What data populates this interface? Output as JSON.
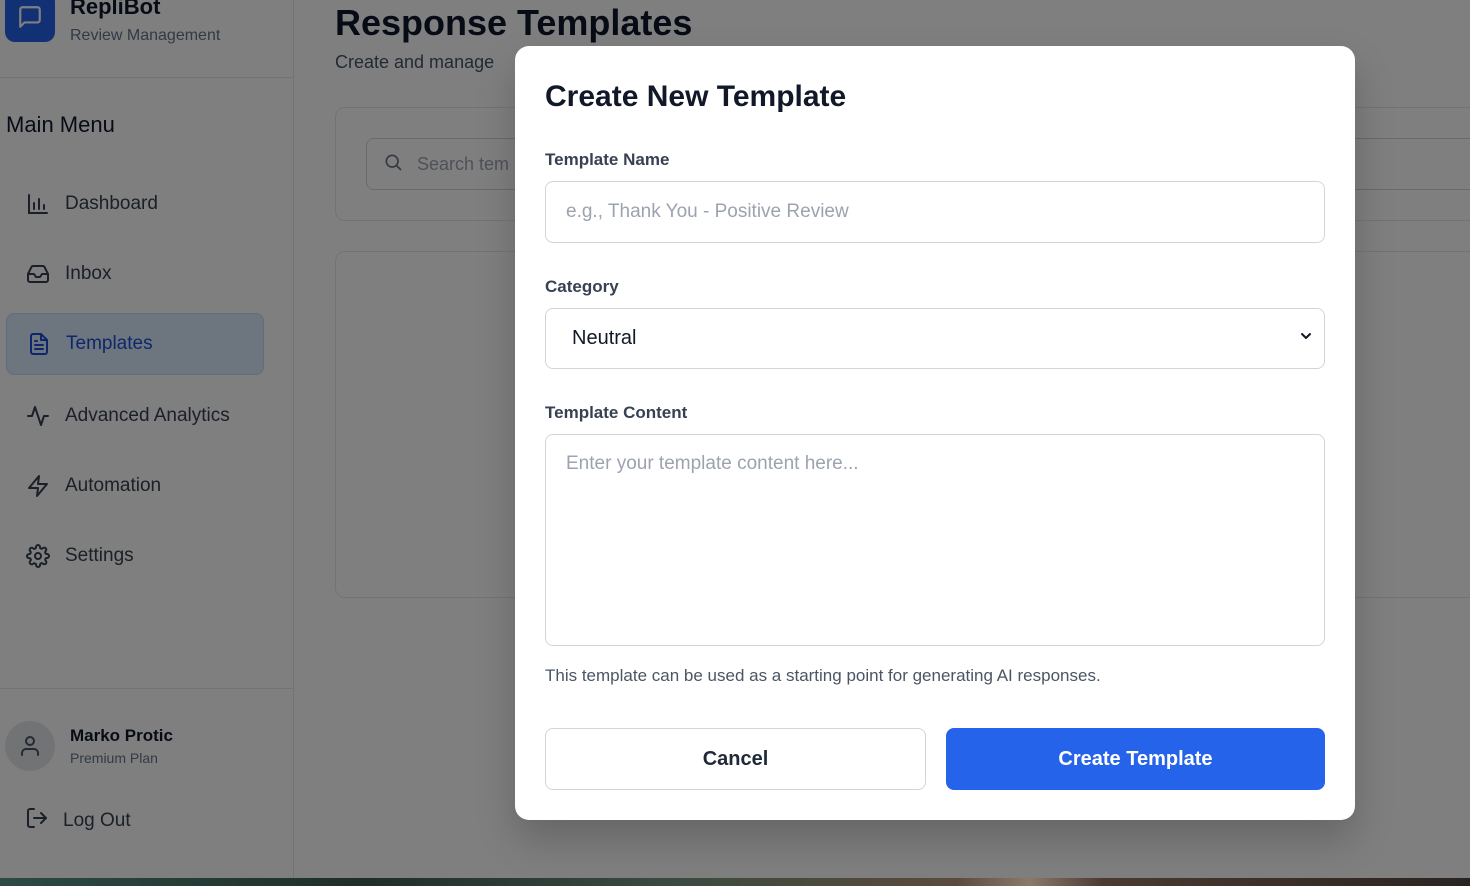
{
  "brand": {
    "name": "RepliBot",
    "subtitle": "Review Management"
  },
  "sidebar": {
    "menu_title": "Main Menu",
    "items": [
      {
        "label": "Dashboard",
        "icon": "bar-chart-icon",
        "active": false
      },
      {
        "label": "Inbox",
        "icon": "inbox-icon",
        "active": false
      },
      {
        "label": "Templates",
        "icon": "file-text-icon",
        "active": true
      },
      {
        "label": "Advanced Analytics",
        "icon": "activity-icon",
        "active": false
      },
      {
        "label": "Automation",
        "icon": "zap-icon",
        "active": false
      },
      {
        "label": "Settings",
        "icon": "gear-icon",
        "active": false
      }
    ]
  },
  "user": {
    "name": "Marko Protic",
    "plan": "Premium Plan",
    "logout_label": "Log Out"
  },
  "main": {
    "title": "Response Templates",
    "subtitle": "Create and manage",
    "search_placeholder": "Search tem"
  },
  "modal": {
    "title": "Create New Template",
    "name_label": "Template Name",
    "name_placeholder": "e.g., Thank You - Positive Review",
    "category_label": "Category",
    "category_value": "Neutral",
    "content_label": "Template Content",
    "content_placeholder": "Enter your template content here...",
    "hint": "This template can be used as a starting point for generating AI responses.",
    "cancel_label": "Cancel",
    "create_label": "Create Template"
  },
  "colors": {
    "accent": "#2563eb",
    "active_bg": "#dbeafe",
    "overlay": "rgba(0,0,0,0.5)"
  }
}
